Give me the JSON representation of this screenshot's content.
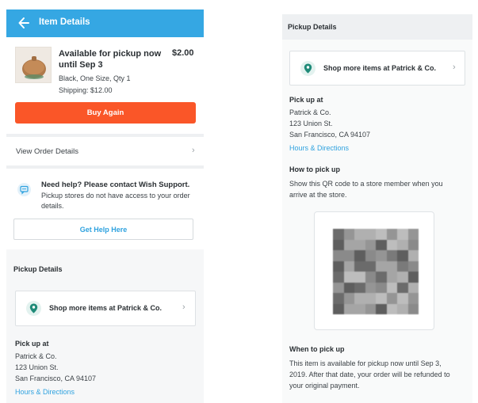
{
  "left": {
    "header": {
      "title": "Item Details",
      "back_icon": "back-arrow-icon"
    },
    "item": {
      "status": "Available for pickup now until Sep 3",
      "price": "$2.00",
      "variant": "Black, One Size, Qty 1",
      "shipping": "Shipping: $12.00"
    },
    "buy_again_label": "Buy Again",
    "view_order_label": "View Order Details",
    "help": {
      "title": "Need help? Please contact Wish Support.",
      "description": "Pickup stores do not have access to your order details.",
      "button_label": "Get Help Here"
    },
    "pickup_details": {
      "header": "Pickup Details",
      "shop_label": "Shop more items at Patrick & Co.",
      "pickup_at_title": "Pick up at",
      "store_name": "Patrick & Co.",
      "street": "123 Union St.",
      "city": "San Francisco, CA 94107",
      "directions_link": "Hours & Directions"
    }
  },
  "right": {
    "header": "Pickup Details",
    "shop_label": "Shop more items at Patrick & Co.",
    "pickup_at_title": "Pick up at",
    "store_name": "Patrick & Co.",
    "street": "123 Union St.",
    "city": "San Francisco, CA 94107",
    "directions_link": "Hours & Directions",
    "how_title": "How to pick up",
    "how_text_1": "Show this QR code to a store member when you",
    "how_text_2": "arrive at the store.",
    "when_title": "When to pick up",
    "when_text_1": "This item is available for pickup now until Sep 3,",
    "when_text_2": "2019. After that date, your order will be refunded to",
    "when_text_3": "your original payment."
  },
  "colors": {
    "header_blue": "#35a7e3",
    "buy_orange": "#fa5628",
    "link_blue": "#2fa2df",
    "pin_teal": "#1f8a78"
  }
}
